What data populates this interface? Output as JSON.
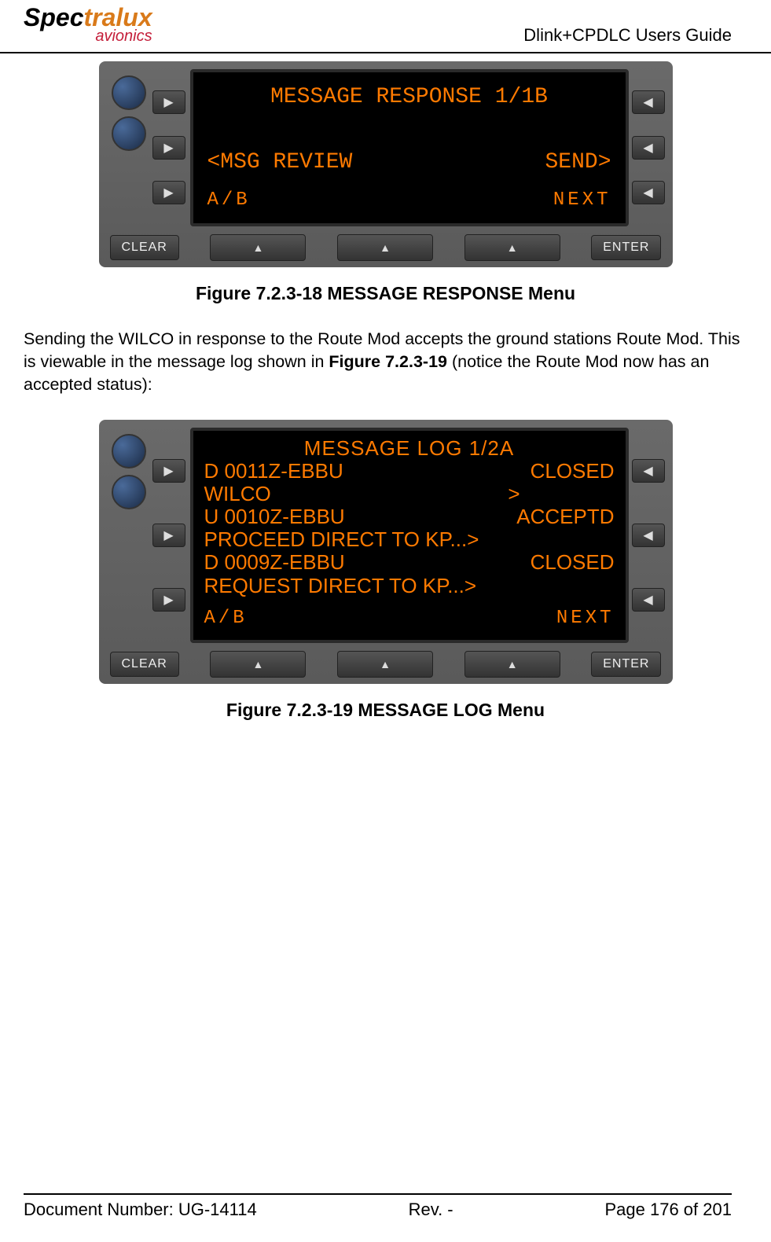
{
  "header": {
    "logo_main": "Spectralux",
    "logo_sub": "avionics",
    "title": "Dlink+CPDLC Users Guide"
  },
  "device1": {
    "screen_title": "MESSAGE RESPONSE 1/1B",
    "msg_review": "<MSG REVIEW",
    "send": "SEND>",
    "ab": "A/B",
    "next": "NEXT",
    "clear_btn": "CLEAR",
    "enter_btn": "ENTER"
  },
  "caption1": "Figure 7.2.3-18 MESSAGE RESPONSE Menu",
  "paragraph": "Sending the WILCO in response to the Route Mod accepts the ground stations Route Mod.  This is viewable in the message log shown in Figure 7.2.3-19 (notice the Route Mod now has an accepted status):",
  "paragraph_bold": "Figure 7.2.3-19",
  "device2": {
    "screen_title": "MESSAGE LOG    1/2A",
    "lines": [
      {
        "left": "D 0011Z-EBBU",
        "right": "CLOSED"
      },
      {
        "left": "WILCO",
        "right": ">"
      },
      {
        "left": "U 0010Z-EBBU",
        "right": "ACCEPTD"
      },
      {
        "left": "PROCEED DIRECT TO KP...>",
        "right": ""
      },
      {
        "left": "D 0009Z-EBBU",
        "right": "CLOSED"
      },
      {
        "left": "REQUEST DIRECT TO KP...>",
        "right": ""
      }
    ],
    "ab": "A/B",
    "next": "NEXT",
    "clear_btn": "CLEAR",
    "enter_btn": "ENTER"
  },
  "caption2": "Figure 7.2.3-19 MESSAGE LOG Menu",
  "footer": {
    "doc_left_label": "Document Number:  ",
    "doc_left_value": "UG-14114",
    "rev": "Rev. -",
    "page": "Page 176 of 201"
  }
}
